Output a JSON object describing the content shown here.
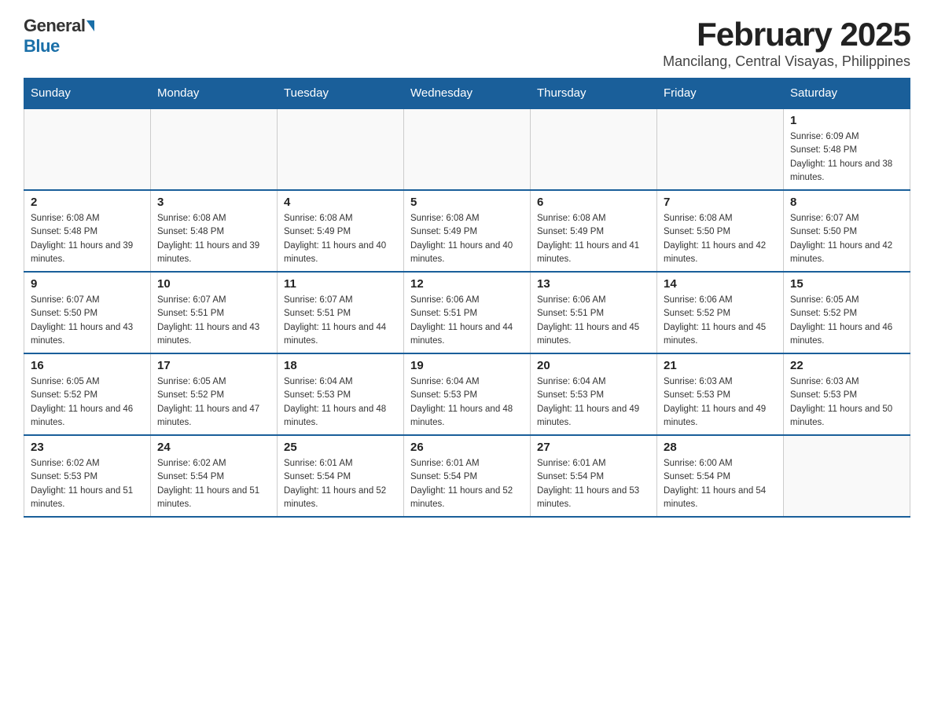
{
  "logo": {
    "general": "General",
    "blue": "Blue"
  },
  "title": "February 2025",
  "subtitle": "Mancilang, Central Visayas, Philippines",
  "days_of_week": [
    "Sunday",
    "Monday",
    "Tuesday",
    "Wednesday",
    "Thursday",
    "Friday",
    "Saturday"
  ],
  "weeks": [
    [
      {
        "day": "",
        "info": ""
      },
      {
        "day": "",
        "info": ""
      },
      {
        "day": "",
        "info": ""
      },
      {
        "day": "",
        "info": ""
      },
      {
        "day": "",
        "info": ""
      },
      {
        "day": "",
        "info": ""
      },
      {
        "day": "1",
        "info": "Sunrise: 6:09 AM\nSunset: 5:48 PM\nDaylight: 11 hours and 38 minutes."
      }
    ],
    [
      {
        "day": "2",
        "info": "Sunrise: 6:08 AM\nSunset: 5:48 PM\nDaylight: 11 hours and 39 minutes."
      },
      {
        "day": "3",
        "info": "Sunrise: 6:08 AM\nSunset: 5:48 PM\nDaylight: 11 hours and 39 minutes."
      },
      {
        "day": "4",
        "info": "Sunrise: 6:08 AM\nSunset: 5:49 PM\nDaylight: 11 hours and 40 minutes."
      },
      {
        "day": "5",
        "info": "Sunrise: 6:08 AM\nSunset: 5:49 PM\nDaylight: 11 hours and 40 minutes."
      },
      {
        "day": "6",
        "info": "Sunrise: 6:08 AM\nSunset: 5:49 PM\nDaylight: 11 hours and 41 minutes."
      },
      {
        "day": "7",
        "info": "Sunrise: 6:08 AM\nSunset: 5:50 PM\nDaylight: 11 hours and 42 minutes."
      },
      {
        "day": "8",
        "info": "Sunrise: 6:07 AM\nSunset: 5:50 PM\nDaylight: 11 hours and 42 minutes."
      }
    ],
    [
      {
        "day": "9",
        "info": "Sunrise: 6:07 AM\nSunset: 5:50 PM\nDaylight: 11 hours and 43 minutes."
      },
      {
        "day": "10",
        "info": "Sunrise: 6:07 AM\nSunset: 5:51 PM\nDaylight: 11 hours and 43 minutes."
      },
      {
        "day": "11",
        "info": "Sunrise: 6:07 AM\nSunset: 5:51 PM\nDaylight: 11 hours and 44 minutes."
      },
      {
        "day": "12",
        "info": "Sunrise: 6:06 AM\nSunset: 5:51 PM\nDaylight: 11 hours and 44 minutes."
      },
      {
        "day": "13",
        "info": "Sunrise: 6:06 AM\nSunset: 5:51 PM\nDaylight: 11 hours and 45 minutes."
      },
      {
        "day": "14",
        "info": "Sunrise: 6:06 AM\nSunset: 5:52 PM\nDaylight: 11 hours and 45 minutes."
      },
      {
        "day": "15",
        "info": "Sunrise: 6:05 AM\nSunset: 5:52 PM\nDaylight: 11 hours and 46 minutes."
      }
    ],
    [
      {
        "day": "16",
        "info": "Sunrise: 6:05 AM\nSunset: 5:52 PM\nDaylight: 11 hours and 46 minutes."
      },
      {
        "day": "17",
        "info": "Sunrise: 6:05 AM\nSunset: 5:52 PM\nDaylight: 11 hours and 47 minutes."
      },
      {
        "day": "18",
        "info": "Sunrise: 6:04 AM\nSunset: 5:53 PM\nDaylight: 11 hours and 48 minutes."
      },
      {
        "day": "19",
        "info": "Sunrise: 6:04 AM\nSunset: 5:53 PM\nDaylight: 11 hours and 48 minutes."
      },
      {
        "day": "20",
        "info": "Sunrise: 6:04 AM\nSunset: 5:53 PM\nDaylight: 11 hours and 49 minutes."
      },
      {
        "day": "21",
        "info": "Sunrise: 6:03 AM\nSunset: 5:53 PM\nDaylight: 11 hours and 49 minutes."
      },
      {
        "day": "22",
        "info": "Sunrise: 6:03 AM\nSunset: 5:53 PM\nDaylight: 11 hours and 50 minutes."
      }
    ],
    [
      {
        "day": "23",
        "info": "Sunrise: 6:02 AM\nSunset: 5:53 PM\nDaylight: 11 hours and 51 minutes."
      },
      {
        "day": "24",
        "info": "Sunrise: 6:02 AM\nSunset: 5:54 PM\nDaylight: 11 hours and 51 minutes."
      },
      {
        "day": "25",
        "info": "Sunrise: 6:01 AM\nSunset: 5:54 PM\nDaylight: 11 hours and 52 minutes."
      },
      {
        "day": "26",
        "info": "Sunrise: 6:01 AM\nSunset: 5:54 PM\nDaylight: 11 hours and 52 minutes."
      },
      {
        "day": "27",
        "info": "Sunrise: 6:01 AM\nSunset: 5:54 PM\nDaylight: 11 hours and 53 minutes."
      },
      {
        "day": "28",
        "info": "Sunrise: 6:00 AM\nSunset: 5:54 PM\nDaylight: 11 hours and 54 minutes."
      },
      {
        "day": "",
        "info": ""
      }
    ]
  ]
}
